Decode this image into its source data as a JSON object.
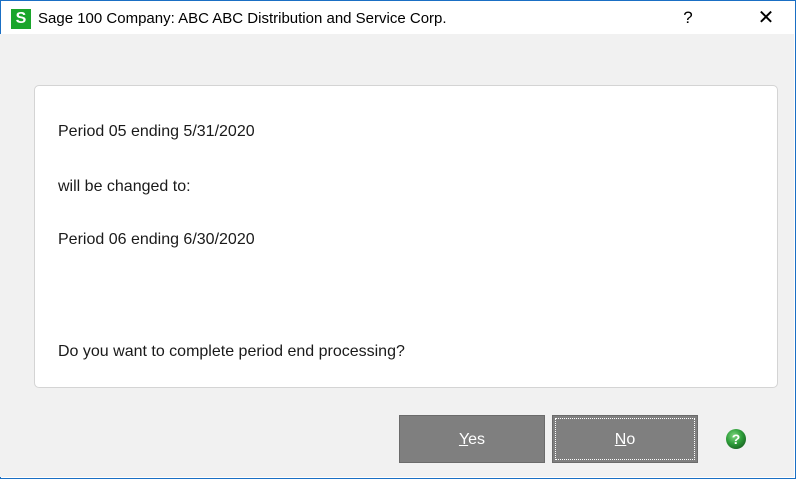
{
  "window": {
    "title": "Sage 100 Company: ABC  ABC Distribution and Service Corp.",
    "help_glyph": "?",
    "close_glyph": "✕",
    "logo_letter": "S"
  },
  "message": {
    "line1": "Period 05 ending 5/31/2020",
    "line2": "will be changed to:",
    "line3": "Period 06 ending 6/30/2020",
    "question": "Do you want to complete period end processing?"
  },
  "buttons": {
    "yes": {
      "mnemonic": "Y",
      "rest": "es"
    },
    "no": {
      "mnemonic": "N",
      "rest": "o"
    }
  },
  "icons": {
    "app_logo": "sage-logo-icon",
    "help": "help-circle-icon",
    "close": "close-icon"
  },
  "colors": {
    "logo_green": "#1aa52b",
    "button_gray": "#7f7f7f",
    "help_green": "#2e9e3a"
  }
}
